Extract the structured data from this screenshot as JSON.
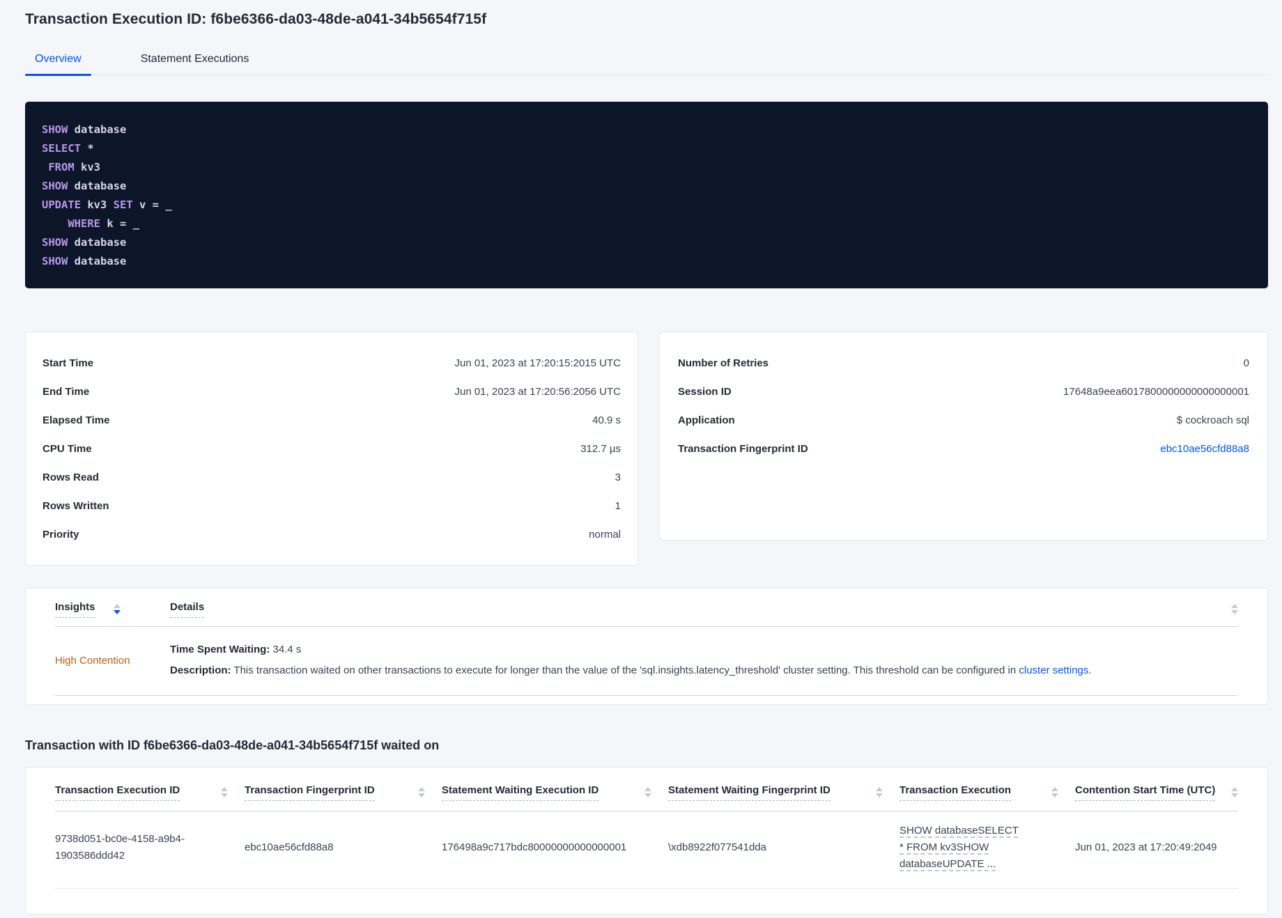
{
  "page": {
    "title": "Transaction Execution ID: f6be6366-da03-48de-a041-34b5654f715f"
  },
  "tabs": {
    "overview": "Overview",
    "statement_executions": "Statement Executions"
  },
  "sql": {
    "l0": {
      "k": "SHOW",
      "r": " database"
    },
    "l1": {
      "k": "SELECT",
      "r": " *"
    },
    "l2": {
      "k": " FROM",
      "r": " kv3"
    },
    "l3": {
      "k": "SHOW",
      "r": " database"
    },
    "l4": {
      "k": "UPDATE",
      "r1": " kv3 ",
      "k2": "SET",
      "r2": " v = _"
    },
    "l5": {
      "k": "    WHERE",
      "r": " k = _"
    },
    "l6": {
      "k": "SHOW",
      "r": " database"
    },
    "l7": {
      "k": "SHOW",
      "r": " database"
    }
  },
  "summary_left": {
    "rows": [
      {
        "label": "Start Time",
        "value": "Jun 01, 2023 at 17:20:15:2015 UTC"
      },
      {
        "label": "End Time",
        "value": "Jun 01, 2023 at 17:20:56:2056 UTC"
      },
      {
        "label": "Elapsed Time",
        "value": "40.9 s"
      },
      {
        "label": "CPU Time",
        "value": "312.7 µs"
      },
      {
        "label": "Rows Read",
        "value": "3"
      },
      {
        "label": "Rows Written",
        "value": "1"
      },
      {
        "label": "Priority",
        "value": "normal"
      }
    ]
  },
  "summary_right": {
    "rows": [
      {
        "label": "Number of Retries",
        "value": "0"
      },
      {
        "label": "Session ID",
        "value": "17648a9eea6017800000000000000001"
      },
      {
        "label": "Application",
        "value": "$ cockroach sql"
      },
      {
        "label": "Transaction Fingerprint ID",
        "value": "ebc10ae56cfd88a8"
      }
    ]
  },
  "insights": {
    "col_insights": "Insights",
    "col_details": "Details",
    "row": {
      "insight": "High Contention",
      "waiting_label": "Time Spent Waiting:",
      "waiting_value": " 34.4 s",
      "desc_label": "Description:",
      "desc_text": " This transaction waited on other transactions to execute for longer than the value of the 'sql.insights.latency_threshold' cluster setting. This threshold can be configured in ",
      "desc_link": "cluster settings",
      "desc_after": "."
    }
  },
  "waited_on": {
    "heading": "Transaction with ID f6be6366-da03-48de-a041-34b5654f715f waited on",
    "columns": [
      "Transaction Execution ID",
      "Transaction Fingerprint ID",
      "Statement Waiting Execution ID",
      "Statement Waiting Fingerprint ID",
      "Transaction Execution",
      "Contention Start Time (UTC)"
    ],
    "row": {
      "txn_execution_id": "9738d051-bc0e-4158-a9b4-1903586ddd42",
      "txn_fingerprint_id": "ebc10ae56cfd88a8",
      "stmt_waiting_execution_id": "176498a9c717bdc80000000000000001",
      "stmt_waiting_fingerprint_id": "\\xdb8922f077541dda",
      "txn_execution": "SHOW databaseSELECT * FROM kv3SHOW databaseUPDATE ...",
      "contention_start": "Jun 01, 2023 at 17:20:49:2049"
    }
  }
}
